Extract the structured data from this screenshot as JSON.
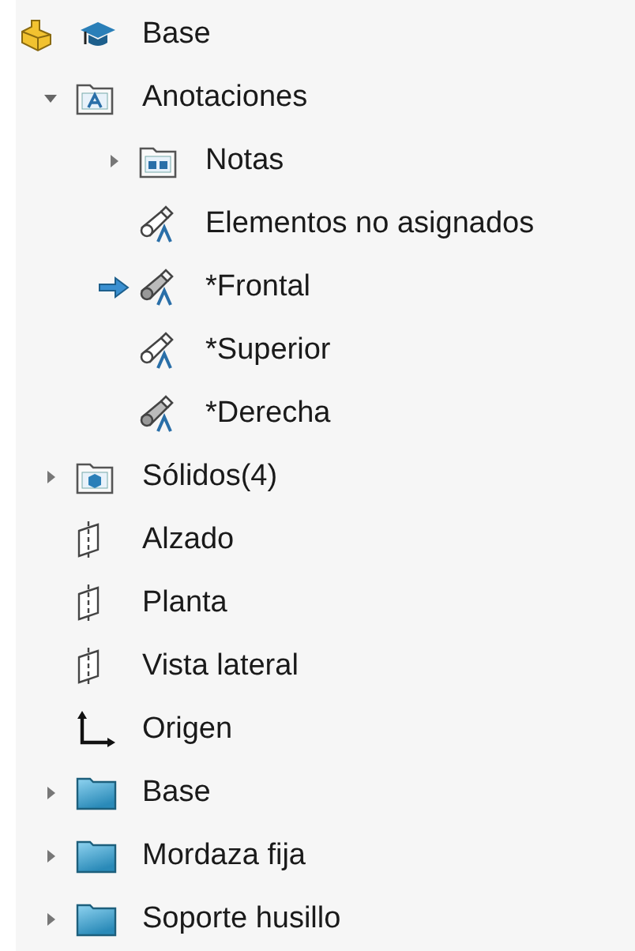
{
  "root": {
    "label": "Base",
    "kind": "part"
  },
  "items": [
    {
      "label": "Anotaciones",
      "kind": "annotations",
      "expanded": true,
      "children": [
        {
          "label": "Notas",
          "kind": "notes",
          "expanded": false,
          "active": false
        },
        {
          "label": "Elementos no asignados",
          "kind": "view",
          "shaded": false,
          "active": false
        },
        {
          "label": "*Frontal",
          "kind": "view",
          "shaded": true,
          "active": true
        },
        {
          "label": "*Superior",
          "kind": "view",
          "shaded": false,
          "active": false
        },
        {
          "label": "*Derecha",
          "kind": "view",
          "shaded": true,
          "active": false
        }
      ]
    },
    {
      "label": "Sólidos(4)",
      "kind": "solids",
      "expanded": false
    },
    {
      "label": "Alzado",
      "kind": "plane"
    },
    {
      "label": "Planta",
      "kind": "plane"
    },
    {
      "label": "Vista lateral",
      "kind": "plane"
    },
    {
      "label": "Origen",
      "kind": "origin"
    },
    {
      "label": "Base",
      "kind": "folder",
      "expanded": false
    },
    {
      "label": "Mordaza fija",
      "kind": "folder",
      "expanded": false
    },
    {
      "label": "Soporte husillo",
      "kind": "folder",
      "expanded": false
    }
  ]
}
